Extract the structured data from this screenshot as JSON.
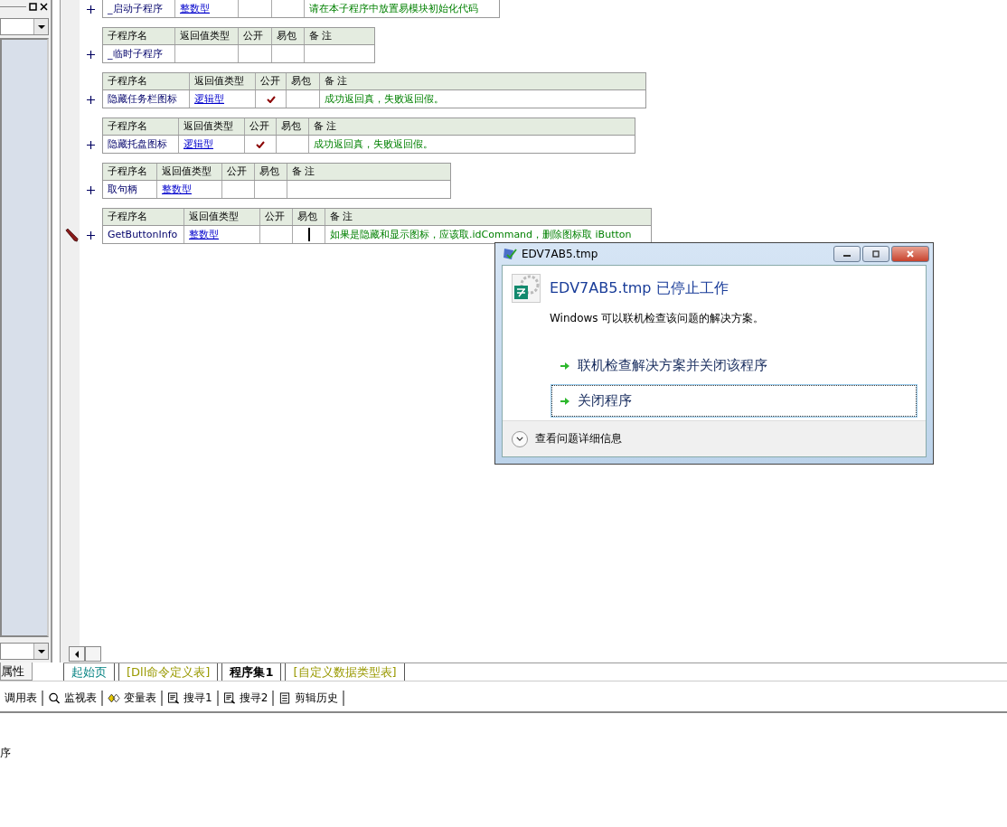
{
  "left_panel": {
    "tab": "属性"
  },
  "tables": [
    {
      "row": {
        "name": "_启动子程序",
        "type": "整数型",
        "public": false,
        "pack": false,
        "note": "请在本子程序中放置易模块初始化代码",
        "editing": false
      }
    },
    {
      "columns": [
        "子程序名",
        "返回值类型",
        "公开",
        "易包",
        "备 注"
      ],
      "row": {
        "name": "_临时子程序",
        "public": false,
        "pack": false,
        "editing": false
      }
    },
    {
      "columns": [
        "子程序名",
        "返回值类型",
        "公开",
        "易包",
        "备 注"
      ],
      "row": {
        "name": "隐藏任务栏图标",
        "type": "逻辑型",
        "public": true,
        "pack": false,
        "note": "成功返回真，失败返回假。",
        "editing": false
      }
    },
    {
      "columns": [
        "子程序名",
        "返回值类型",
        "公开",
        "易包",
        "备 注"
      ],
      "row": {
        "name": "隐藏托盘图标",
        "type": "逻辑型",
        "public": true,
        "pack": false,
        "note": "成功返回真，失败返回假。",
        "editing": false
      }
    },
    {
      "columns": [
        "子程序名",
        "返回值类型",
        "公开",
        "易包",
        "备 注"
      ],
      "row": {
        "name": "取句柄",
        "type": "整数型",
        "public": false,
        "pack": false,
        "editing": false
      }
    },
    {
      "columns": [
        "子程序名",
        "返回值类型",
        "公开",
        "易包",
        "备 注"
      ],
      "row": {
        "name": "GetButtonInfo",
        "type": "整数型",
        "public": false,
        "pack": false,
        "note": "如果是隐藏和显示图标，应该取.idCommand，删除图标取 iButton",
        "editing": true
      }
    }
  ],
  "tabs": [
    {
      "label": "起始页",
      "selected": false,
      "color": "#008080"
    },
    {
      "label": "[Dll命令定义表]",
      "selected": false,
      "color": "#999900"
    },
    {
      "label": "程序集1",
      "selected": true,
      "color": "#000000"
    },
    {
      "label": "[自定义数据类型表]",
      "selected": false,
      "color": "#999900"
    }
  ],
  "toolbar": [
    {
      "label": "调用表",
      "kind": "none"
    },
    {
      "label": "监视表",
      "kind": "search"
    },
    {
      "label": "变量表",
      "kind": "variables"
    },
    {
      "label": "搜寻1",
      "kind": "find"
    },
    {
      "label": "搜寻2",
      "kind": "find"
    },
    {
      "label": "剪辑历史",
      "kind": "clip"
    }
  ],
  "output": {
    "lines": [
      "序"
    ]
  },
  "dialog": {
    "title": "EDV7AB5.tmp",
    "heading": "EDV7AB5.tmp 已停止工作",
    "message": "Windows 可以联机检查该问题的解决方案。",
    "options": [
      {
        "label": "联机检查解决方案并关闭该程序",
        "selected": false
      },
      {
        "label": "关闭程序",
        "selected": true
      }
    ],
    "details": "查看问题详细信息"
  }
}
